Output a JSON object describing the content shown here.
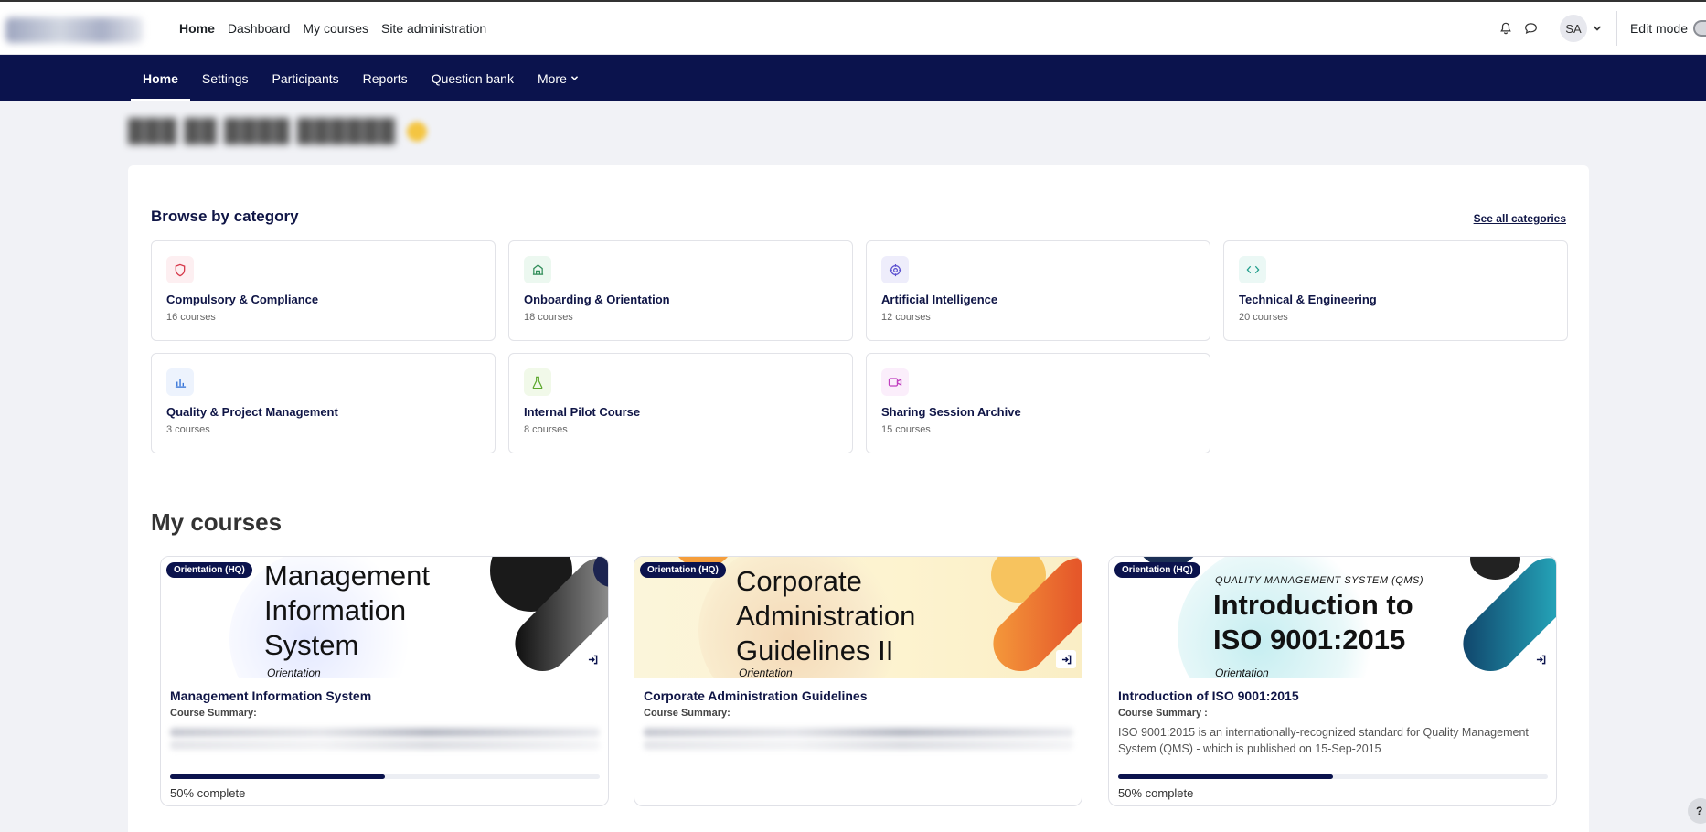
{
  "topnav": {
    "items": [
      "Home",
      "Dashboard",
      "My courses",
      "Site administration"
    ],
    "user_initials": "SA",
    "edit_mode_label": "Edit mode"
  },
  "secnav": {
    "items": [
      "Home",
      "Settings",
      "Participants",
      "Reports",
      "Question bank",
      "More"
    ]
  },
  "categories": {
    "title": "Browse by category",
    "see_all": "See all categories",
    "items": [
      {
        "name": "Compulsory & Compliance",
        "count": "16 courses",
        "icon": "shield-icon",
        "color": "#d6394a",
        "bg": "#fdeff1"
      },
      {
        "name": "Onboarding & Orientation",
        "count": "18 courses",
        "icon": "building-icon",
        "color": "#2e8b57",
        "bg": "#ecf8f0"
      },
      {
        "name": "Artificial Intelligence",
        "count": "12 courses",
        "icon": "brain-icon",
        "color": "#5a4fcf",
        "bg": "#eeedfb"
      },
      {
        "name": "Technical & Engineering",
        "count": "20 courses",
        "icon": "code-icon",
        "color": "#1f9d8b",
        "bg": "#ebf8f5"
      },
      {
        "name": "Quality & Project Management",
        "count": "3 courses",
        "icon": "bar-chart-icon",
        "color": "#2f6fd6",
        "bg": "#edf3fd"
      },
      {
        "name": "Internal Pilot Course",
        "count": "8 courses",
        "icon": "flask-icon",
        "color": "#5aa72a",
        "bg": "#f1f9e9"
      },
      {
        "name": "Sharing Session Archive",
        "count": "15 courses",
        "icon": "video-icon",
        "color": "#c03fbf",
        "bg": "#fbeefb"
      }
    ]
  },
  "my_courses": {
    "title": "My courses",
    "items": [
      {
        "badge": "Orientation (HQ)",
        "banner_lines": [
          "Management",
          "Information",
          "System"
        ],
        "banner_top": "",
        "banner_sub": "Orientation",
        "title": "Management Information System",
        "summary_label": "Course Summary:",
        "description": "",
        "progress": 50,
        "progress_text": "50% complete"
      },
      {
        "badge": "Orientation (HQ)",
        "banner_lines": [
          "Corporate",
          "Administration",
          "Guidelines II"
        ],
        "banner_top": "",
        "banner_sub": "Orientation",
        "title": "Corporate Administration Guidelines",
        "summary_label": "Course Summary:",
        "description": "",
        "progress": null,
        "progress_text": ""
      },
      {
        "badge": "Orientation (HQ)",
        "banner_lines": [
          "Introduction to",
          "ISO 9001:2015"
        ],
        "banner_top": "QUALITY MANAGEMENT SYSTEM (QMS)",
        "banner_sub": "Orientation",
        "title": "Introduction of ISO 9001:2015",
        "summary_label": "Course Summary :",
        "description": "ISO 9001:2015 is an internationally-recognized standard for Quality Management System (QMS) - which is published on 15-Sep-2015",
        "progress": 50,
        "progress_text": "50% complete"
      }
    ]
  }
}
